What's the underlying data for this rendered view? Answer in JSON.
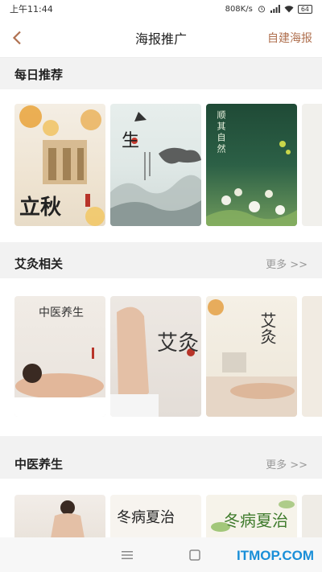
{
  "status": {
    "time": "上午11:44",
    "speed": "808K/s",
    "battery": "64"
  },
  "nav": {
    "title": "海报推广",
    "action": "自建海报"
  },
  "sections": [
    {
      "title": "每日推荐",
      "more": ""
    },
    {
      "title": "艾灸相关",
      "more": "更多 >>"
    },
    {
      "title": "中医养生",
      "more": "更多 >>"
    }
  ],
  "posters": {
    "daily": [
      "立秋",
      "生",
      "顺其自然"
    ],
    "moxa": [
      "中医养生",
      "艾灸",
      "艾灸"
    ],
    "tcm": [
      "",
      "冬病夏治",
      "冬病夏治"
    ]
  },
  "watermark": "ITMOP.COM"
}
